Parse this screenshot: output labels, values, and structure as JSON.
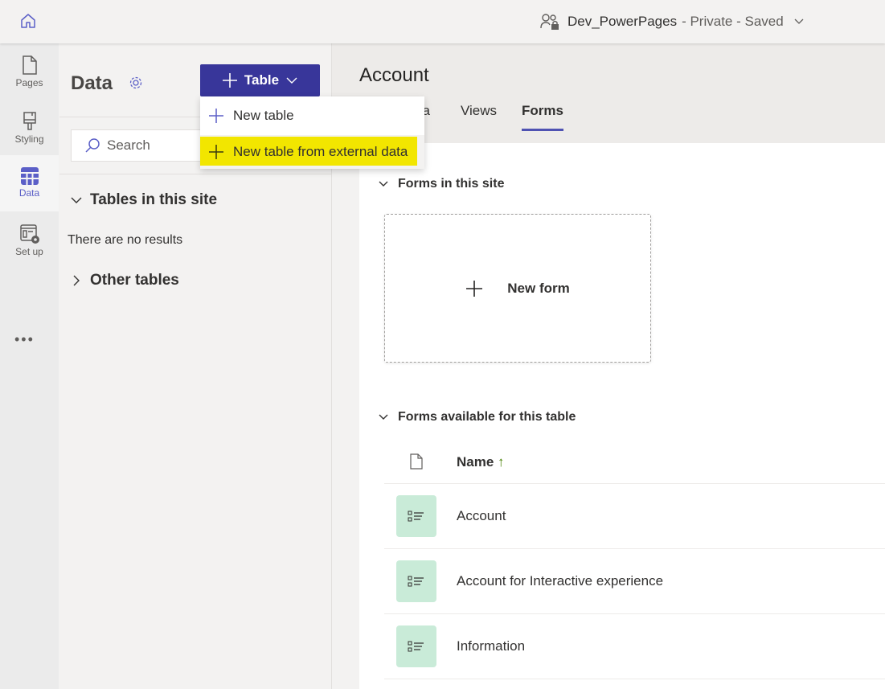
{
  "topbar": {
    "site_name": "Dev_PowerPages",
    "site_status": "- Private - Saved"
  },
  "rail": {
    "items": [
      {
        "label": "Pages"
      },
      {
        "label": "Styling"
      },
      {
        "label": "Data"
      },
      {
        "label": "Set up"
      }
    ],
    "more": "•••"
  },
  "panel": {
    "title": "Data",
    "search_placeholder": "Search",
    "tables_in_site": "Tables in this site",
    "no_results": "There are no results",
    "other_tables": "Other tables"
  },
  "table_button": {
    "label": "Table"
  },
  "menu": {
    "items": [
      {
        "label": "New table"
      },
      {
        "label": "New table from external data"
      }
    ]
  },
  "accent": "#38369a",
  "highlight": "#f2e600",
  "main": {
    "title": "Account",
    "tabs": [
      {
        "label": "Data"
      },
      {
        "label": "Views"
      },
      {
        "label": "Forms"
      }
    ],
    "forms_in_site": "Forms in this site",
    "new_form": "New form",
    "forms_available": "Forms available for this table",
    "name_header": "Name",
    "sort_indicator": "↑",
    "forms": [
      {
        "name": "Account"
      },
      {
        "name": "Account for Interactive experience"
      },
      {
        "name": "Information"
      }
    ]
  }
}
